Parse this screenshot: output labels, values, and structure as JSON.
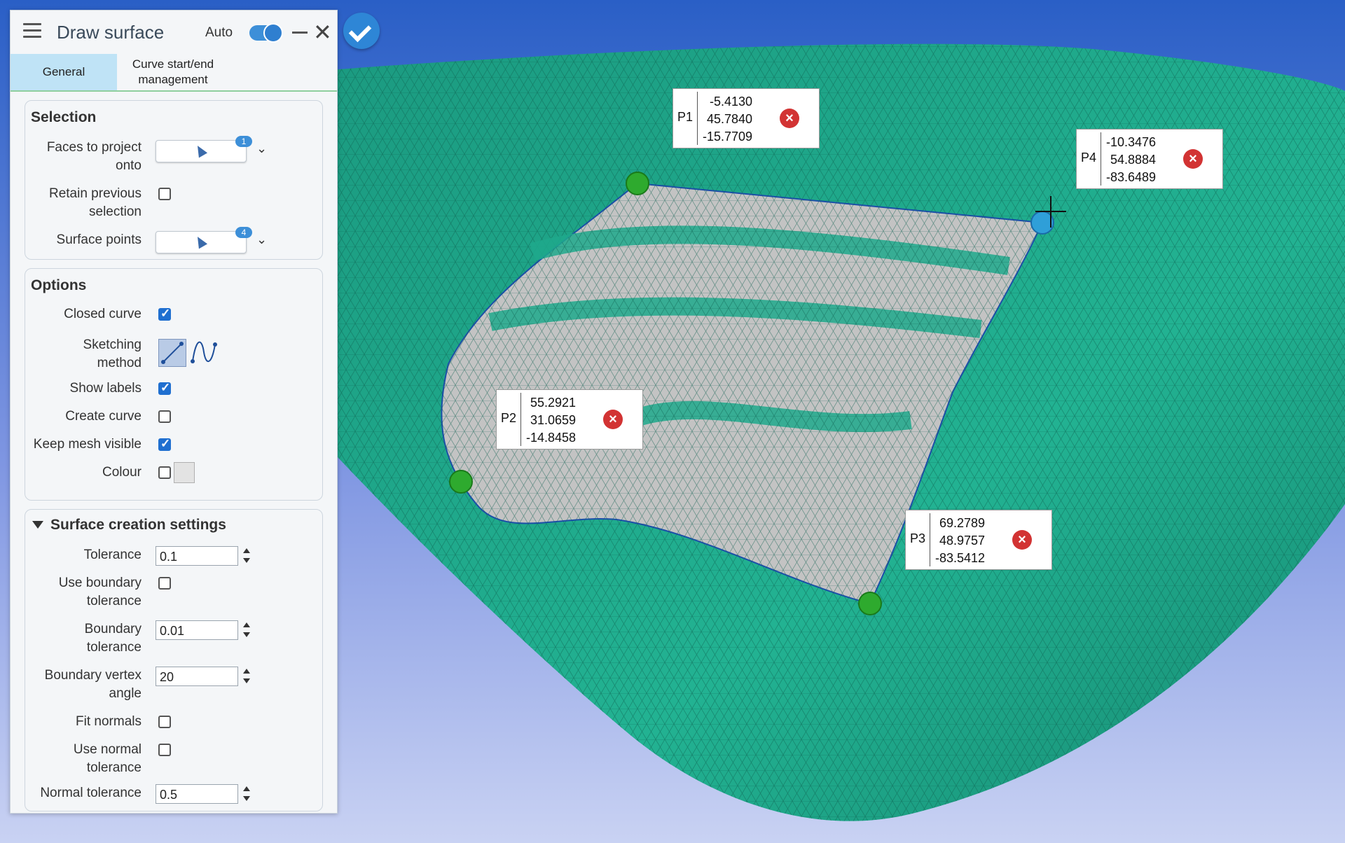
{
  "panel": {
    "title": "Draw surface",
    "auto_label": "Auto",
    "auto_on": true,
    "tabs": [
      {
        "label": "General",
        "active": true
      },
      {
        "label": "Curve start/end management",
        "active": false
      }
    ],
    "selection": {
      "title": "Selection",
      "faces_label": "Faces to project onto",
      "faces_count": "1",
      "retain_label": "Retain previous selection",
      "retain_checked": false,
      "points_label": "Surface points",
      "points_count": "4"
    },
    "options": {
      "title": "Options",
      "closed_curve_label": "Closed curve",
      "closed_curve_checked": true,
      "sketching_label": "Sketching method",
      "show_labels_label": "Show labels",
      "show_labels_checked": true,
      "create_curve_label": "Create curve",
      "create_curve_checked": false,
      "keep_mesh_label": "Keep mesh visible",
      "keep_mesh_checked": true,
      "colour_label": "Colour",
      "colour_checked": false
    },
    "surface_settings": {
      "title": "Surface creation settings",
      "tolerance_label": "Tolerance",
      "tolerance_value": "0.1",
      "use_boundary_label": "Use boundary tolerance",
      "use_boundary_checked": false,
      "boundary_tol_label": "Boundary tolerance",
      "boundary_tol_value": "0.01",
      "boundary_vertex_label": "Boundary vertex angle",
      "boundary_vertex_value": "20",
      "fit_normals_label": "Fit normals",
      "fit_normals_checked": false,
      "use_normal_label": "Use normal tolerance",
      "use_normal_checked": false,
      "normal_tol_label": "Normal tolerance",
      "normal_tol_value": "0.5"
    }
  },
  "points": [
    {
      "name": "P1",
      "values": [
        "-5.4130",
        "45.7840",
        "-15.7709"
      ]
    },
    {
      "name": "P2",
      "values": [
        "55.2921",
        "31.0659",
        "-14.8458"
      ]
    },
    {
      "name": "P3",
      "values": [
        "69.2789",
        "48.9757",
        "-83.5412"
      ]
    },
    {
      "name": "P4",
      "values": [
        "-10.3476",
        "54.8884",
        "-83.6489"
      ]
    }
  ],
  "colors": {
    "mesh": "#1ea98c",
    "background_top": "#2b62c8",
    "background_bottom": "#c6d0f2",
    "patch": "#c4c4c4",
    "accent": "#2e86d6"
  }
}
